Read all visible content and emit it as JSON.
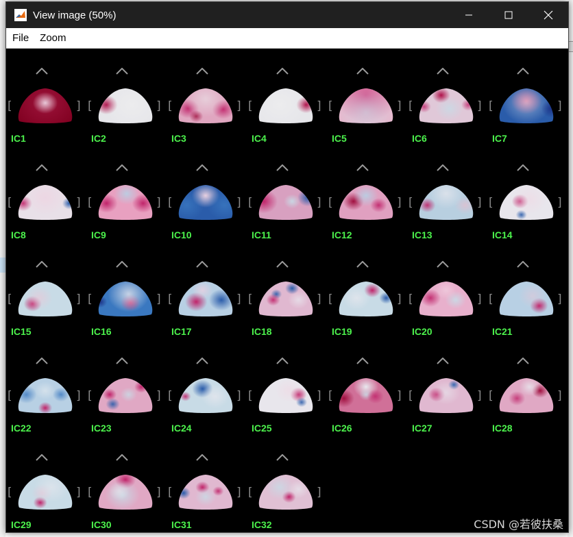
{
  "window": {
    "title": "View image (50%)",
    "menu": [
      "File",
      "Zoom"
    ],
    "controls": [
      "minimize",
      "maximize",
      "close"
    ]
  },
  "components": [
    {
      "label": "IC1",
      "base": "#800020",
      "blobs": [
        [
          "#a0153e",
          0.5,
          0.45,
          0.5,
          0.9
        ],
        [
          "#e8c8d8",
          0.5,
          0.45,
          0.18,
          1
        ]
      ]
    },
    {
      "label": "IC2",
      "base": "#e6e6ea",
      "blobs": [
        [
          "#b0124a",
          0.2,
          0.5,
          0.16,
          1
        ],
        [
          "#f0f0f0",
          0.6,
          0.5,
          0.4,
          0.6
        ]
      ]
    },
    {
      "label": "IC3",
      "base": "#e0a6c0",
      "blobs": [
        [
          "#c0246a",
          0.22,
          0.6,
          0.16,
          0.9
        ],
        [
          "#c0246a",
          0.78,
          0.62,
          0.16,
          0.9
        ],
        [
          "#e8d8e0",
          0.5,
          0.35,
          0.3,
          0.8
        ],
        [
          "#a01040",
          0.35,
          0.8,
          0.1,
          0.8
        ]
      ]
    },
    {
      "label": "IC4",
      "base": "#e6e6ea",
      "blobs": [
        [
          "#b0124a",
          0.82,
          0.5,
          0.14,
          1
        ],
        [
          "#f0f0f0",
          0.4,
          0.5,
          0.4,
          0.6
        ]
      ]
    },
    {
      "label": "IC5",
      "base": "#e8b6cc",
      "blobs": [
        [
          "#d04080",
          0.5,
          0.25,
          0.45,
          0.9
        ],
        [
          "#c8dbe6",
          0.5,
          0.7,
          0.45,
          0.6
        ]
      ]
    },
    {
      "label": "IC6",
      "base": "#e0c8d8",
      "blobs": [
        [
          "#b0124a",
          0.42,
          0.25,
          0.13,
          1
        ],
        [
          "#c8dbe6",
          0.55,
          0.6,
          0.2,
          0.8
        ],
        [
          "#c0246a",
          0.15,
          0.55,
          0.1,
          0.8
        ],
        [
          "#c0246a",
          0.85,
          0.5,
          0.1,
          0.8
        ]
      ]
    },
    {
      "label": "IC7",
      "base": "#2a5caa",
      "blobs": [
        [
          "#d06090",
          0.5,
          0.4,
          0.22,
          1
        ],
        [
          "#e8e8f0",
          0.5,
          0.45,
          0.35,
          0.5
        ],
        [
          "#1a2a80",
          0.9,
          0.6,
          0.15,
          0.8
        ]
      ]
    },
    {
      "label": "IC8",
      "base": "#e8e0e8",
      "blobs": [
        [
          "#c0246a",
          0.15,
          0.55,
          0.13,
          0.9
        ],
        [
          "#2a5caa",
          0.88,
          0.55,
          0.1,
          1
        ],
        [
          "#f0d0e0",
          0.5,
          0.4,
          0.3,
          0.6
        ]
      ]
    },
    {
      "label": "IC9",
      "base": "#e8a0c0",
      "blobs": [
        [
          "#c0246a",
          0.2,
          0.55,
          0.16,
          1
        ],
        [
          "#c0246a",
          0.78,
          0.55,
          0.16,
          1
        ],
        [
          "#b8d0e4",
          0.52,
          0.3,
          0.18,
          0.9
        ]
      ]
    },
    {
      "label": "IC10",
      "base": "#2a5caa",
      "blobs": [
        [
          "#e8d0e0",
          0.5,
          0.35,
          0.2,
          1
        ],
        [
          "#3a78c0",
          0.2,
          0.6,
          0.25,
          0.8
        ],
        [
          "#3a78c0",
          0.8,
          0.6,
          0.25,
          0.8
        ]
      ]
    },
    {
      "label": "IC11",
      "base": "#d8a0c0",
      "blobs": [
        [
          "#c0246a",
          0.15,
          0.5,
          0.2,
          1
        ],
        [
          "#2a5caa",
          0.85,
          0.4,
          0.15,
          1
        ],
        [
          "#c8dbe6",
          0.6,
          0.5,
          0.12,
          0.9
        ]
      ]
    },
    {
      "label": "IC12",
      "base": "#e0a0c0",
      "blobs": [
        [
          "#a01040",
          0.3,
          0.5,
          0.15,
          1
        ],
        [
          "#b8d0e4",
          0.5,
          0.35,
          0.18,
          0.9
        ],
        [
          "#c0246a",
          0.7,
          0.6,
          0.12,
          0.9
        ]
      ]
    },
    {
      "label": "IC13",
      "base": "#b8cfe0",
      "blobs": [
        [
          "#c0246a",
          0.2,
          0.6,
          0.12,
          0.9
        ],
        [
          "#e0c0d0",
          0.8,
          0.6,
          0.15,
          0.8
        ],
        [
          "#e8e8ee",
          0.5,
          0.3,
          0.25,
          0.7
        ]
      ]
    },
    {
      "label": "IC14",
      "base": "#e8e6ec",
      "blobs": [
        [
          "#c0246a",
          0.4,
          0.5,
          0.12,
          0.9
        ],
        [
          "#2a5caa",
          0.42,
          0.85,
          0.08,
          0.9
        ],
        [
          "#f0d8e4",
          0.55,
          0.45,
          0.25,
          0.6
        ]
      ]
    },
    {
      "label": "IC15",
      "base": "#c8dbe6",
      "blobs": [
        [
          "#c0246a",
          0.3,
          0.65,
          0.13,
          1
        ],
        [
          "#e8c8d8",
          0.4,
          0.5,
          0.2,
          0.7
        ]
      ]
    },
    {
      "label": "IC16",
      "base": "#3a78c0",
      "blobs": [
        [
          "#c0246a",
          0.58,
          0.62,
          0.14,
          1
        ],
        [
          "#e8e8ee",
          0.55,
          0.4,
          0.3,
          0.8
        ],
        [
          "#1a2a80",
          0.1,
          0.6,
          0.1,
          0.9
        ]
      ]
    },
    {
      "label": "IC17",
      "base": "#b8d0e4",
      "blobs": [
        [
          "#c0246a",
          0.35,
          0.6,
          0.16,
          1
        ],
        [
          "#2a5caa",
          0.75,
          0.55,
          0.18,
          1
        ],
        [
          "#f0d0e0",
          0.45,
          0.3,
          0.15,
          0.7
        ]
      ]
    },
    {
      "label": "IC18",
      "base": "#e0b8d0",
      "blobs": [
        [
          "#2a5caa",
          0.6,
          0.25,
          0.1,
          1
        ],
        [
          "#2a5caa",
          0.35,
          0.4,
          0.08,
          0.9
        ],
        [
          "#c0246a",
          0.3,
          0.55,
          0.1,
          0.9
        ],
        [
          "#e8e8ee",
          0.7,
          0.55,
          0.15,
          0.7
        ]
      ]
    },
    {
      "label": "IC19",
      "base": "#c8dbe6",
      "blobs": [
        [
          "#c0246a",
          0.6,
          0.3,
          0.12,
          1
        ],
        [
          "#2a5caa",
          0.82,
          0.5,
          0.1,
          1
        ],
        [
          "#e8e8ee",
          0.35,
          0.5,
          0.2,
          0.7
        ]
      ]
    },
    {
      "label": "IC20",
      "base": "#e8b0cc",
      "blobs": [
        [
          "#c0246a",
          0.25,
          0.5,
          0.15,
          0.9
        ],
        [
          "#c8dbe6",
          0.65,
          0.55,
          0.15,
          0.9
        ],
        [
          "#f0d0e0",
          0.5,
          0.3,
          0.15,
          0.7
        ]
      ]
    },
    {
      "label": "IC21",
      "base": "#b8d0e4",
      "blobs": [
        [
          "#c0246a",
          0.7,
          0.7,
          0.13,
          1
        ],
        [
          "#e0c8d8",
          0.6,
          0.45,
          0.2,
          0.6
        ]
      ]
    },
    {
      "label": "IC22",
      "base": "#b8d0e4",
      "blobs": [
        [
          "#c0246a",
          0.5,
          0.85,
          0.1,
          1
        ],
        [
          "#3a78c0",
          0.2,
          0.5,
          0.15,
          0.8
        ],
        [
          "#3a78c0",
          0.75,
          0.5,
          0.12,
          0.8
        ],
        [
          "#e0e8ee",
          0.5,
          0.4,
          0.15,
          0.7
        ]
      ]
    },
    {
      "label": "IC23",
      "base": "#e0a8c4",
      "blobs": [
        [
          "#c0246a",
          0.75,
          0.3,
          0.1,
          1
        ],
        [
          "#c0246a",
          0.25,
          0.5,
          0.1,
          1
        ],
        [
          "#2a5caa",
          0.3,
          0.75,
          0.1,
          0.9
        ],
        [
          "#c8dbe6",
          0.55,
          0.5,
          0.12,
          0.8
        ]
      ]
    },
    {
      "label": "IC24",
      "base": "#c8dbe6",
      "blobs": [
        [
          "#2a5caa",
          0.45,
          0.35,
          0.15,
          1
        ],
        [
          "#c0246a",
          0.18,
          0.55,
          0.08,
          0.9
        ],
        [
          "#e8e8ee",
          0.65,
          0.55,
          0.2,
          0.7
        ]
      ]
    },
    {
      "label": "IC25",
      "base": "#e8e6ec",
      "blobs": [
        [
          "#c0246a",
          0.7,
          0.5,
          0.12,
          1
        ],
        [
          "#2a5caa",
          0.75,
          0.7,
          0.08,
          0.9
        ],
        [
          "#f0d8e4",
          0.55,
          0.4,
          0.2,
          0.6
        ]
      ]
    },
    {
      "label": "IC26",
      "base": "#d07098",
      "blobs": [
        [
          "#a01040",
          0.15,
          0.6,
          0.15,
          1
        ],
        [
          "#e8e8ee",
          0.5,
          0.3,
          0.18,
          1
        ],
        [
          "#c8dbe6",
          0.5,
          0.5,
          0.1,
          0.8
        ],
        [
          "#c0246a",
          0.65,
          0.55,
          0.12,
          0.8
        ]
      ]
    },
    {
      "label": "IC27",
      "base": "#e0b8d0",
      "blobs": [
        [
          "#2a5caa",
          0.62,
          0.25,
          0.08,
          1
        ],
        [
          "#c0246a",
          0.35,
          0.5,
          0.12,
          0.9
        ],
        [
          "#e8e8ee",
          0.5,
          0.45,
          0.2,
          0.6
        ]
      ]
    },
    {
      "label": "IC28",
      "base": "#e0a8c4",
      "blobs": [
        [
          "#a01040",
          0.72,
          0.4,
          0.12,
          1
        ],
        [
          "#e8e8ee",
          0.55,
          0.3,
          0.15,
          0.8
        ],
        [
          "#c0246a",
          0.35,
          0.6,
          0.12,
          0.8
        ]
      ]
    },
    {
      "label": "IC29",
      "base": "#c8dbe6",
      "blobs": [
        [
          "#c0246a",
          0.42,
          0.8,
          0.1,
          1
        ],
        [
          "#e0c8d8",
          0.45,
          0.55,
          0.15,
          0.8
        ],
        [
          "#e8e8ee",
          0.6,
          0.4,
          0.25,
          0.6
        ]
      ]
    },
    {
      "label": "IC30",
      "base": "#e0a8c4",
      "blobs": [
        [
          "#c0246a",
          0.5,
          0.2,
          0.15,
          1
        ],
        [
          "#c8dbe6",
          0.45,
          0.6,
          0.25,
          0.9
        ],
        [
          "#e8e8ee",
          0.4,
          0.5,
          0.15,
          0.6
        ]
      ]
    },
    {
      "label": "IC31",
      "base": "#e0b8d0",
      "blobs": [
        [
          "#2a5caa",
          0.15,
          0.55,
          0.1,
          1
        ],
        [
          "#c0246a",
          0.45,
          0.4,
          0.1,
          1
        ],
        [
          "#c0246a",
          0.7,
          0.5,
          0.08,
          0.9
        ],
        [
          "#c8dbe6",
          0.5,
          0.65,
          0.15,
          0.8
        ]
      ]
    },
    {
      "label": "IC32",
      "base": "#e0c0d4",
      "blobs": [
        [
          "#c0246a",
          0.55,
          0.65,
          0.1,
          1
        ],
        [
          "#c8dbe6",
          0.4,
          0.4,
          0.2,
          0.8
        ],
        [
          "#e8e8ee",
          0.7,
          0.45,
          0.15,
          0.7
        ]
      ]
    }
  ],
  "watermark": "CSDN @若彼扶桑"
}
